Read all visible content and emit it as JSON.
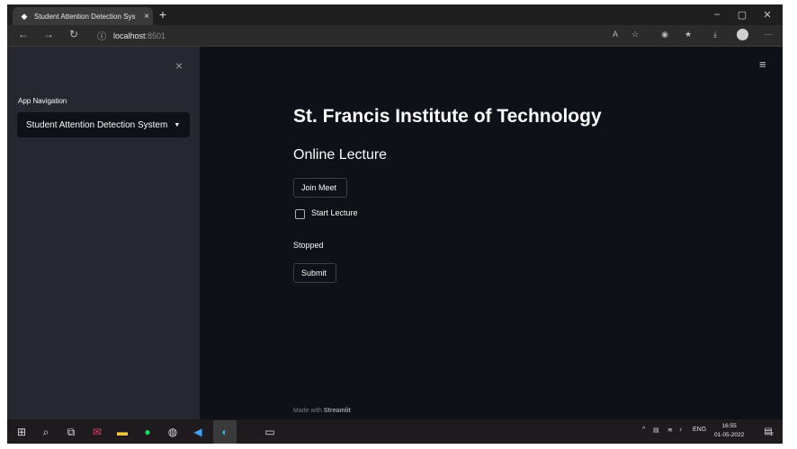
{
  "browser": {
    "tab_title": "Student Attention Detection Sys",
    "tab_close": "×",
    "new_tab": "+",
    "url_host": "localhost",
    "url_port": ":8501",
    "window_controls": [
      "–",
      "▢",
      "✕"
    ]
  },
  "sidebar": {
    "close": "×",
    "nav_label": "App Navigation",
    "selected_app": "Student Attention Detection System"
  },
  "main": {
    "menu_icon": "≡",
    "title": "St. Francis Institute of Technology",
    "subheader": "Online Lecture",
    "join_button": "Join Meet",
    "checkbox_label": "Start Lecture",
    "status": "Stopped",
    "submit_button": "Submit",
    "footer_prefix": "Made with ",
    "footer_brand": "Streamlit"
  },
  "taskbar": {
    "tray_lang": "ENG",
    "time": "16:55",
    "date": "01-05-2022",
    "notification_count": "2"
  }
}
